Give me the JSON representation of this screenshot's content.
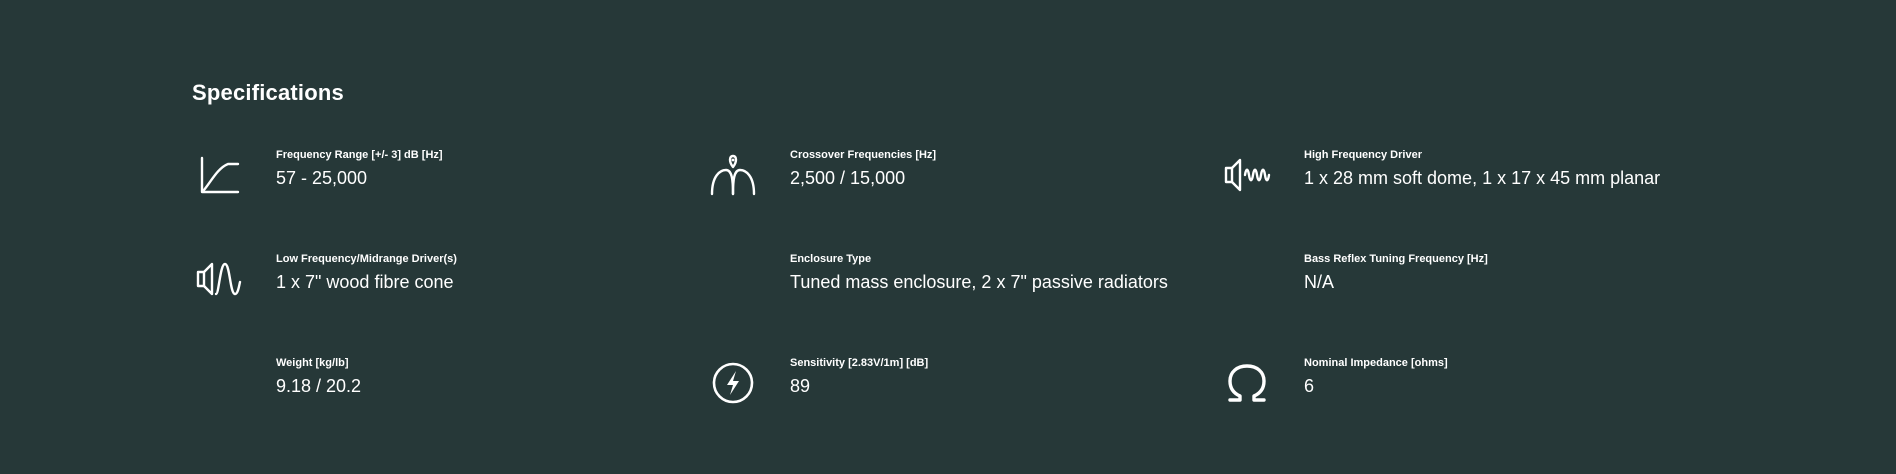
{
  "section": {
    "title": "Specifications"
  },
  "specs": [
    {
      "icon": "frequency-curve-icon",
      "label": "Frequency Range [+/- 3] dB [Hz]",
      "value": "57 - 25,000"
    },
    {
      "icon": "crossover-icon",
      "label": "Crossover Frequencies [Hz]",
      "value": "2,500 / 15,000"
    },
    {
      "icon": "high-frequency-driver-icon",
      "label": "High Frequency Driver",
      "value": "1 x 28 mm soft dome, 1 x 17 x 45 mm planar"
    },
    {
      "icon": "low-frequency-driver-icon",
      "label": "Low Frequency/Midrange Driver(s)",
      "value": "1 x 7\" wood fibre cone"
    },
    {
      "icon": "",
      "label": "Enclosure Type",
      "value": "Tuned mass enclosure, 2 x 7\" passive radiators"
    },
    {
      "icon": "",
      "label": "Bass Reflex Tuning Frequency [Hz]",
      "value": "N/A"
    },
    {
      "icon": "",
      "label": "Weight [kg/lb]",
      "value": "9.18 / 20.2"
    },
    {
      "icon": "sensitivity-bolt-icon",
      "label": "Sensitivity [2.83V/1m] [dB]",
      "value": "89"
    },
    {
      "icon": "omega-impedance-icon",
      "label": "Nominal Impedance [ohms]",
      "value": "6"
    }
  ],
  "colors": {
    "background": "#263838",
    "text": "#ffffff"
  }
}
